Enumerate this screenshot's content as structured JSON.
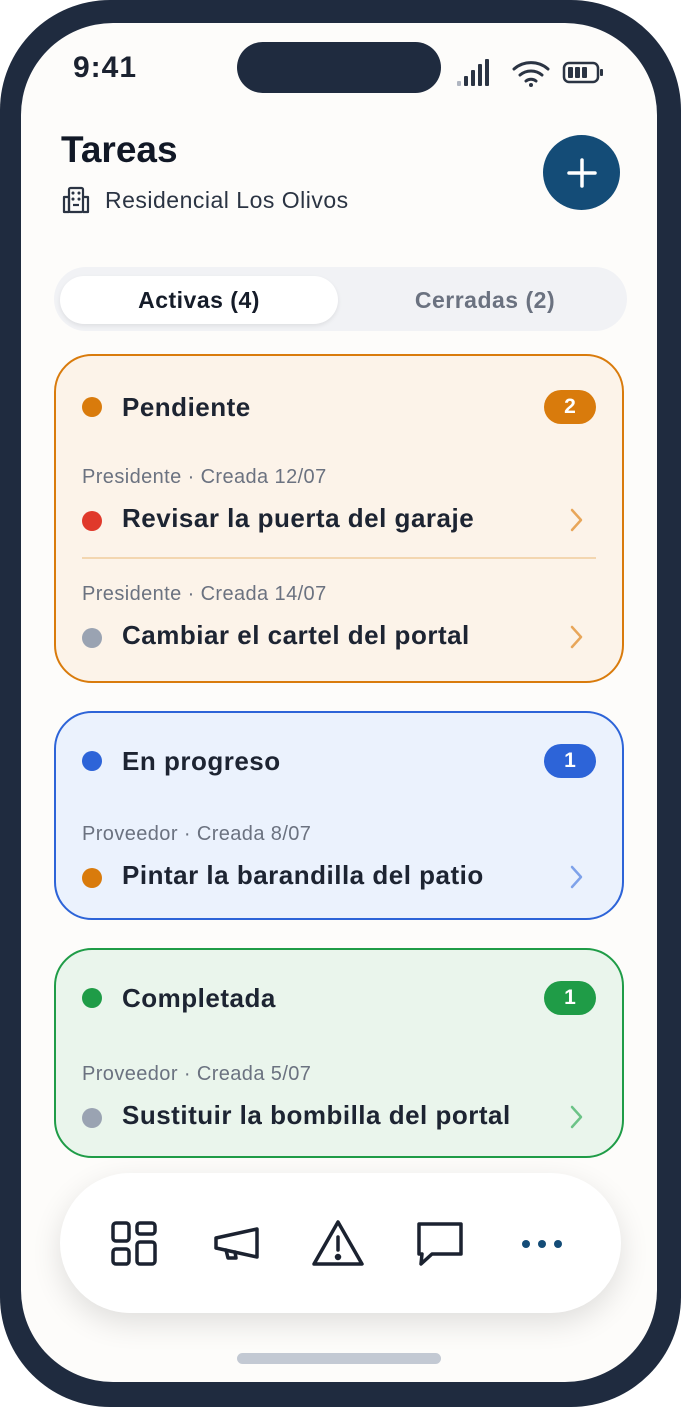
{
  "status_bar": {
    "time": "9:41"
  },
  "header": {
    "title": "Tareas",
    "community": "Residencial Los Olivos",
    "add_icon": "plus-icon"
  },
  "segments": {
    "active_label": "Activas (4)",
    "closed_label": "Cerradas (2)"
  },
  "groups": [
    {
      "status": "Pendiente",
      "count": "2",
      "accent": "#d97b0c",
      "tasks": [
        {
          "meta": "Presidente · Creada 12/07",
          "title": "Revisar la puerta del garaje",
          "priority_color": "#e0392b"
        },
        {
          "meta": "Presidente · Creada 14/07",
          "title": "Cambiar el cartel del portal",
          "priority_color": "#9aa3b2"
        }
      ]
    },
    {
      "status": "En progreso",
      "count": "1",
      "accent": "#2d64d8",
      "tasks": [
        {
          "meta": "Proveedor · Creada 8/07",
          "title": "Pintar la barandilla del patio",
          "priority_color": "#d97b0c"
        }
      ]
    },
    {
      "status": "Completada",
      "count": "1",
      "accent": "#1f9c47",
      "tasks": [
        {
          "meta": "Proveedor · Creada 5/07",
          "title": "Sustituir la bombilla del portal",
          "priority_color": "#9aa3b2"
        }
      ]
    }
  ],
  "bottom_nav": {
    "items": [
      "dashboard-grid-icon",
      "megaphone-icon",
      "warning-triangle-icon",
      "chat-bubble-icon",
      "more-dots-icon"
    ],
    "active_color": "#144c77"
  },
  "colors": {
    "brand": "#144c77",
    "frame": "#1f2b3f"
  }
}
